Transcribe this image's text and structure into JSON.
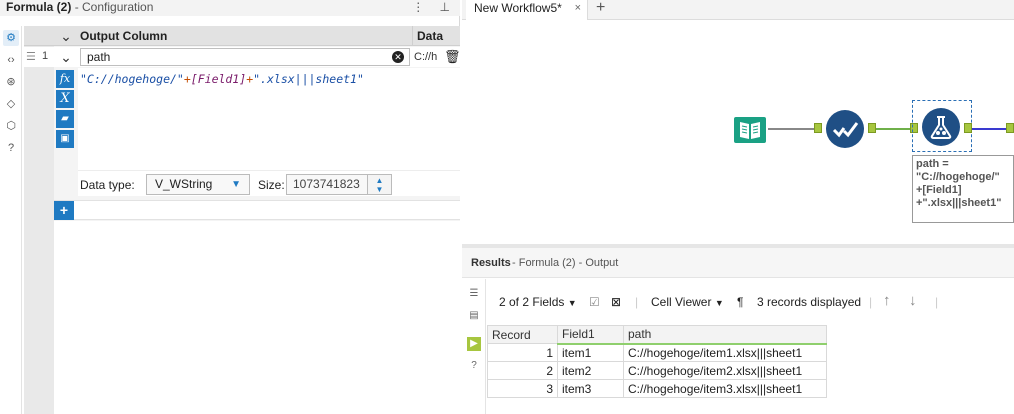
{
  "config": {
    "title": "Formula (2)",
    "subtitle": "- Configuration",
    "header_icons": [
      "more-icon",
      "pin-icon"
    ],
    "rail_icons": [
      "gear-icon",
      "code-icon",
      "compass-icon",
      "tag-icon",
      "cube-icon",
      "help-icon"
    ],
    "columns": {
      "output": "Output Column",
      "data": "Data"
    },
    "row": {
      "number": "1",
      "name": "path",
      "data_preview": "C://h"
    },
    "expression": {
      "part1": "\"C://hogehoge/\"",
      "op1": "+",
      "field": "[Field1]",
      "op2": "+",
      "part2": "\".xlsx|||sheet1\""
    },
    "tool_icons": [
      "fx",
      "X",
      "open",
      "save"
    ],
    "data_type_label": "Data type:",
    "data_type_value": "V_WString",
    "size_label": "Size:",
    "size_value": "1073741823"
  },
  "canvas": {
    "tab_label": "New Workflow5*",
    "tab_close": "×",
    "new_tab": "+",
    "annotation": [
      "path =",
      "\"C://hogehoge/\"",
      "+[Field1]",
      "+\".xlsx|||sheet1\""
    ]
  },
  "results": {
    "title": "Results",
    "subtitle": "- Formula (2) - Output",
    "fields_label": "2 of 2 Fields",
    "cell_viewer": "Cell Viewer",
    "records": "3 records displayed",
    "columns": [
      "Record",
      "Field1",
      "path"
    ],
    "rows": [
      [
        "1",
        "item1",
        "C://hogehoge/item1.xlsx|||sheet1"
      ],
      [
        "2",
        "item2",
        "C://hogehoge/item2.xlsx|||sheet1"
      ],
      [
        "3",
        "item3",
        "C://hogehoge/item3.xlsx|||sheet1"
      ]
    ]
  }
}
